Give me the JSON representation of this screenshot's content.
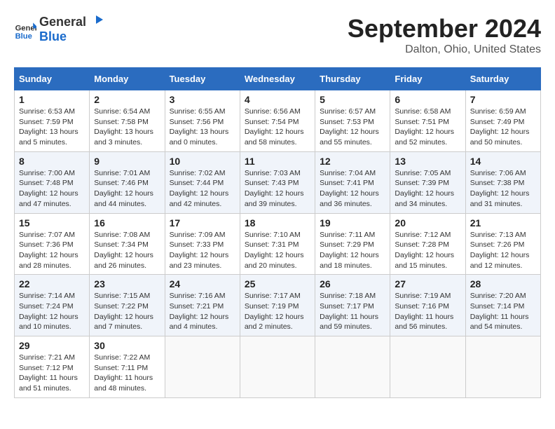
{
  "header": {
    "logo": {
      "general": "General",
      "blue": "Blue"
    },
    "month": "September 2024",
    "location": "Dalton, Ohio, United States"
  },
  "days_of_week": [
    "Sunday",
    "Monday",
    "Tuesday",
    "Wednesday",
    "Thursday",
    "Friday",
    "Saturday"
  ],
  "weeks": [
    [
      {
        "day": "1",
        "sunrise": "6:53 AM",
        "sunset": "7:59 PM",
        "daylight": "13 hours and 5 minutes."
      },
      {
        "day": "2",
        "sunrise": "6:54 AM",
        "sunset": "7:58 PM",
        "daylight": "13 hours and 3 minutes."
      },
      {
        "day": "3",
        "sunrise": "6:55 AM",
        "sunset": "7:56 PM",
        "daylight": "13 hours and 0 minutes."
      },
      {
        "day": "4",
        "sunrise": "6:56 AM",
        "sunset": "7:54 PM",
        "daylight": "12 hours and 58 minutes."
      },
      {
        "day": "5",
        "sunrise": "6:57 AM",
        "sunset": "7:53 PM",
        "daylight": "12 hours and 55 minutes."
      },
      {
        "day": "6",
        "sunrise": "6:58 AM",
        "sunset": "7:51 PM",
        "daylight": "12 hours and 52 minutes."
      },
      {
        "day": "7",
        "sunrise": "6:59 AM",
        "sunset": "7:49 PM",
        "daylight": "12 hours and 50 minutes."
      }
    ],
    [
      {
        "day": "8",
        "sunrise": "7:00 AM",
        "sunset": "7:48 PM",
        "daylight": "12 hours and 47 minutes."
      },
      {
        "day": "9",
        "sunrise": "7:01 AM",
        "sunset": "7:46 PM",
        "daylight": "12 hours and 44 minutes."
      },
      {
        "day": "10",
        "sunrise": "7:02 AM",
        "sunset": "7:44 PM",
        "daylight": "12 hours and 42 minutes."
      },
      {
        "day": "11",
        "sunrise": "7:03 AM",
        "sunset": "7:43 PM",
        "daylight": "12 hours and 39 minutes."
      },
      {
        "day": "12",
        "sunrise": "7:04 AM",
        "sunset": "7:41 PM",
        "daylight": "12 hours and 36 minutes."
      },
      {
        "day": "13",
        "sunrise": "7:05 AM",
        "sunset": "7:39 PM",
        "daylight": "12 hours and 34 minutes."
      },
      {
        "day": "14",
        "sunrise": "7:06 AM",
        "sunset": "7:38 PM",
        "daylight": "12 hours and 31 minutes."
      }
    ],
    [
      {
        "day": "15",
        "sunrise": "7:07 AM",
        "sunset": "7:36 PM",
        "daylight": "12 hours and 28 minutes."
      },
      {
        "day": "16",
        "sunrise": "7:08 AM",
        "sunset": "7:34 PM",
        "daylight": "12 hours and 26 minutes."
      },
      {
        "day": "17",
        "sunrise": "7:09 AM",
        "sunset": "7:33 PM",
        "daylight": "12 hours and 23 minutes."
      },
      {
        "day": "18",
        "sunrise": "7:10 AM",
        "sunset": "7:31 PM",
        "daylight": "12 hours and 20 minutes."
      },
      {
        "day": "19",
        "sunrise": "7:11 AM",
        "sunset": "7:29 PM",
        "daylight": "12 hours and 18 minutes."
      },
      {
        "day": "20",
        "sunrise": "7:12 AM",
        "sunset": "7:28 PM",
        "daylight": "12 hours and 15 minutes."
      },
      {
        "day": "21",
        "sunrise": "7:13 AM",
        "sunset": "7:26 PM",
        "daylight": "12 hours and 12 minutes."
      }
    ],
    [
      {
        "day": "22",
        "sunrise": "7:14 AM",
        "sunset": "7:24 PM",
        "daylight": "12 hours and 10 minutes."
      },
      {
        "day": "23",
        "sunrise": "7:15 AM",
        "sunset": "7:22 PM",
        "daylight": "12 hours and 7 minutes."
      },
      {
        "day": "24",
        "sunrise": "7:16 AM",
        "sunset": "7:21 PM",
        "daylight": "12 hours and 4 minutes."
      },
      {
        "day": "25",
        "sunrise": "7:17 AM",
        "sunset": "7:19 PM",
        "daylight": "12 hours and 2 minutes."
      },
      {
        "day": "26",
        "sunrise": "7:18 AM",
        "sunset": "7:17 PM",
        "daylight": "11 hours and 59 minutes."
      },
      {
        "day": "27",
        "sunrise": "7:19 AM",
        "sunset": "7:16 PM",
        "daylight": "11 hours and 56 minutes."
      },
      {
        "day": "28",
        "sunrise": "7:20 AM",
        "sunset": "7:14 PM",
        "daylight": "11 hours and 54 minutes."
      }
    ],
    [
      {
        "day": "29",
        "sunrise": "7:21 AM",
        "sunset": "7:12 PM",
        "daylight": "11 hours and 51 minutes."
      },
      {
        "day": "30",
        "sunrise": "7:22 AM",
        "sunset": "7:11 PM",
        "daylight": "11 hours and 48 minutes."
      },
      null,
      null,
      null,
      null,
      null
    ]
  ],
  "labels": {
    "sunrise": "Sunrise:",
    "sunset": "Sunset:",
    "daylight": "Daylight:"
  }
}
